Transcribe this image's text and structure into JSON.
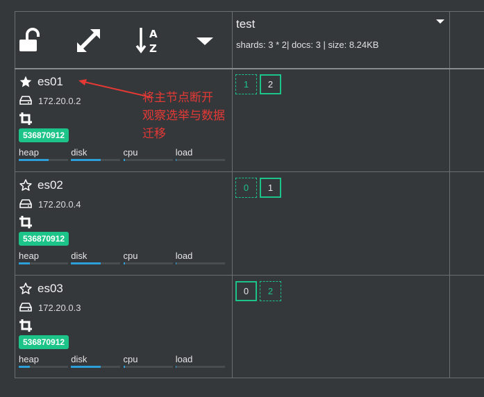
{
  "toolbar": {
    "icons": [
      "unlock-icon",
      "expand-icon",
      "sort-alpha-icon",
      "caret-down-icon"
    ]
  },
  "index": {
    "name": "test",
    "stats": "shards: 3 * 2| docs: 3 | size: 8.24KB"
  },
  "nodes": [
    {
      "name": "es01",
      "master": true,
      "ip": "172.20.0.2",
      "badge": "536870912",
      "metrics": [
        {
          "label": "heap",
          "fill": 0.6
        },
        {
          "label": "disk",
          "fill": 0.6
        },
        {
          "label": "cpu",
          "fill": 0.03
        },
        {
          "label": "load",
          "fill": 0.02
        }
      ],
      "shards": [
        {
          "label": "1",
          "primary": false
        },
        {
          "label": "2",
          "primary": true
        }
      ]
    },
    {
      "name": "es02",
      "master": false,
      "ip": "172.20.0.4",
      "badge": "536870912",
      "metrics": [
        {
          "label": "heap",
          "fill": 0.22
        },
        {
          "label": "disk",
          "fill": 0.6
        },
        {
          "label": "cpu",
          "fill": 0.03
        },
        {
          "label": "load",
          "fill": 0.02
        }
      ],
      "shards": [
        {
          "label": "0",
          "primary": false
        },
        {
          "label": "1",
          "primary": true
        }
      ]
    },
    {
      "name": "es03",
      "master": false,
      "ip": "172.20.0.3",
      "badge": "536870912",
      "metrics": [
        {
          "label": "heap",
          "fill": 0.22
        },
        {
          "label": "disk",
          "fill": 0.6
        },
        {
          "label": "cpu",
          "fill": 0.03
        },
        {
          "label": "load",
          "fill": 0.02
        }
      ],
      "shards": [
        {
          "label": "0",
          "primary": true
        },
        {
          "label": "2",
          "primary": false
        }
      ]
    }
  ],
  "annotation": {
    "lines": [
      "将主节点断开",
      "观察选举与数据",
      "迁移"
    ]
  },
  "colors": {
    "background": "#34383b",
    "grid": "#6b6f72",
    "accent": "#1cc489",
    "bar": "#2d9fd9",
    "annotation": "#e53935"
  }
}
